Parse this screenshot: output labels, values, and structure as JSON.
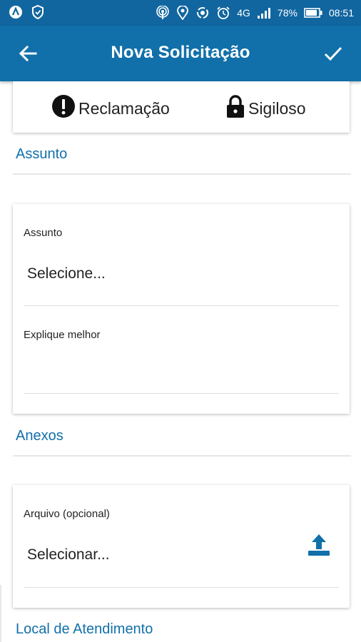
{
  "status_bar": {
    "icons_left": [
      "app-logo-icon",
      "shield-icon"
    ],
    "icons_right": [
      "hotspot-icon",
      "location-icon",
      "sync-icon",
      "alarm-icon",
      "network-4g-icon",
      "signal-icon",
      "battery-icon"
    ],
    "network": "4G",
    "battery": "78%",
    "time": "08:51"
  },
  "app_bar": {
    "title": "Nova Solicitação",
    "back_icon": "arrow-left-icon",
    "confirm_icon": "check-icon"
  },
  "type_selector": {
    "options": [
      {
        "label": "Reclamação",
        "icon": "exclamation-circle-icon"
      },
      {
        "label": "Sigiloso",
        "icon": "lock-icon"
      }
    ]
  },
  "sections": {
    "assunto": {
      "title": "Assunto",
      "subject_label": "Assunto",
      "subject_value": "Selecione...",
      "explain_label": "Explique melhor"
    },
    "anexos": {
      "title": "Anexos",
      "file_label": "Arquivo (opcional)",
      "file_value": "Selecionar...",
      "upload_icon": "upload-icon"
    },
    "local": {
      "title": "Local de Atendimento"
    }
  },
  "colors": {
    "primary": "#1170aa",
    "status_bar": "#1166a0",
    "text": "#222222",
    "divider": "#e6e6e6"
  }
}
